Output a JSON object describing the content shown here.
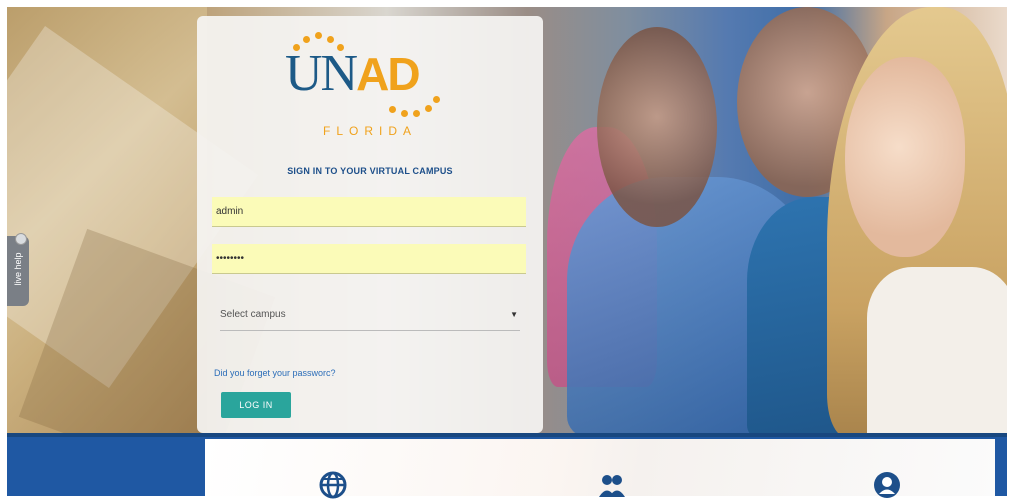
{
  "logo": {
    "primary_un": "UN",
    "primary_ad": "AD",
    "subtitle": "FLORIDA"
  },
  "login": {
    "heading": "SIGN IN TO YOUR VIRTUAL CAMPUS",
    "username_value": "admin",
    "password_value": "••••••••",
    "campus_select": "Select campus",
    "forgot_link": "Did you forget your passworc?",
    "login_button": "LOG IN"
  },
  "live_help": {
    "label": "live help"
  },
  "bottom_icons": [
    "globe-icon",
    "users-icon",
    "user-circle-icon"
  ],
  "colors": {
    "brand_blue": "#1d5a87",
    "brand_orange": "#f0a21c",
    "button_teal": "#2aa59c",
    "field_yellow": "#fbfbb8"
  }
}
